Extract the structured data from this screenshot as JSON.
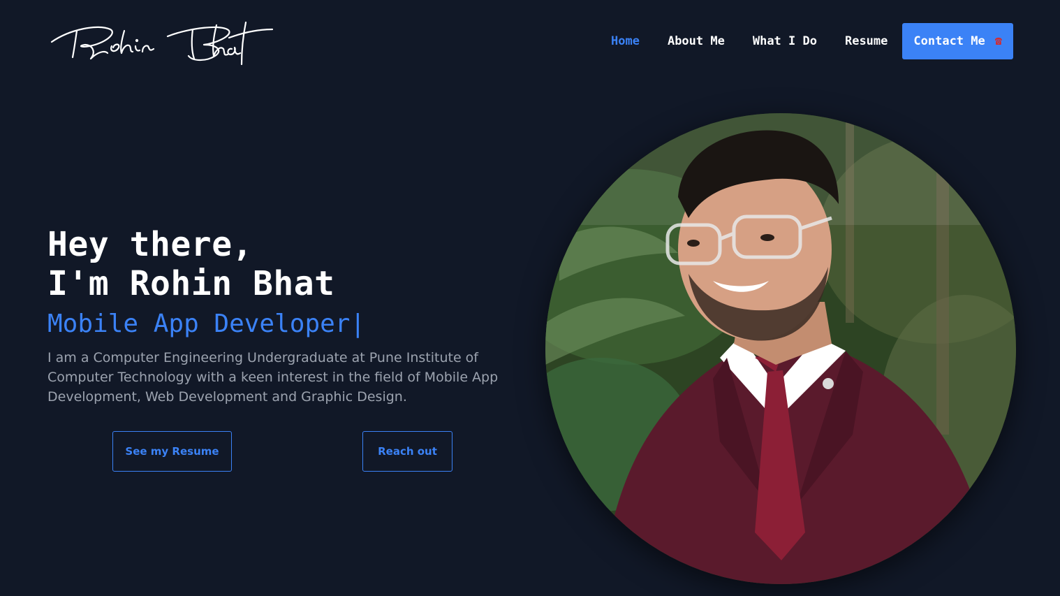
{
  "logo": {
    "alt": "Rohin Bhat"
  },
  "nav": {
    "items": [
      {
        "label": "Home",
        "active": true
      },
      {
        "label": "About Me",
        "active": false
      },
      {
        "label": "What I Do",
        "active": false
      },
      {
        "label": "Resume",
        "active": false
      }
    ],
    "contact_label": "Contact Me",
    "contact_icon": "☎"
  },
  "hero": {
    "greeting_line1": "Hey there,",
    "greeting_line2": "I'm Rohin Bhat",
    "role": "Mobile App Developer",
    "cursor": "|",
    "bio": "I am a Computer Engineering Undergraduate at Pune Institute of Computer Technology with a keen interest in the field of Mobile App Development, Web Development and Graphic Design.",
    "resume_button": "See my Resume",
    "reach_button": "Reach out"
  },
  "colors": {
    "background": "#111827",
    "accent": "#3b82f6",
    "muted_text": "#9ca3af"
  },
  "icons": [
    "phone-icon"
  ]
}
